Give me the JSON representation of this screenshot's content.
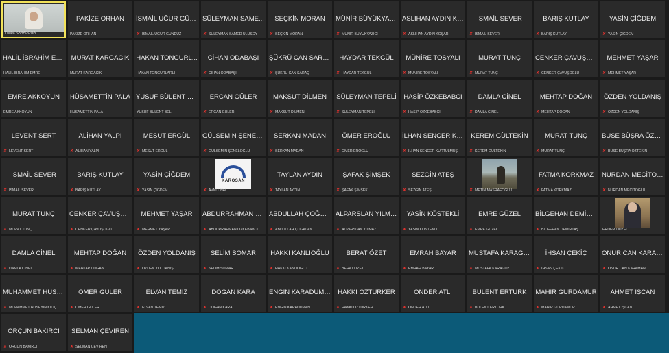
{
  "self": {
    "small": "Tuğba KARABOĞA"
  },
  "tiles": [
    {
      "big": "PAKİZE ORHAN",
      "small": "PAKİZE ORHAN",
      "mic": false
    },
    {
      "big": "İSMAİL UĞUR GÜN...",
      "small": "İSMAİL UĞUR GÜNDÜZ",
      "mic": true
    },
    {
      "big": "SÜLEYMAN SAME...",
      "small": "SÜLEYMAN SAMED ULUSOY",
      "mic": true
    },
    {
      "big": "SEÇKİN MORAN",
      "small": "SEÇKİN MORAN",
      "mic": true
    },
    {
      "big": "MÜNİR BÜYÜKYAZI...",
      "small": "MÜNİR BÜYÜKYAZICI",
      "mic": true
    },
    {
      "big": "ASLIHAN AYDIN KO...",
      "small": "ASLIHAN AYDIN KOŞAR",
      "mic": true
    },
    {
      "big": "İSMAİL SEVER",
      "small": "İSMAİL SEVER",
      "mic": true
    },
    {
      "big": "BARIŞ KUTLAY",
      "small": "BARIŞ KUTLAY",
      "mic": true
    },
    {
      "big": "YASİN ÇİĞDEM",
      "small": "YASİN ÇİĞDEM",
      "mic": true
    },
    {
      "big": "HALİL İBRAHİM EM...",
      "small": "HALİL İBRAHİM EMRE",
      "mic": false
    },
    {
      "big": "MURAT KARGACIK",
      "small": "MURAT KARGACIK",
      "mic": false
    },
    {
      "big": "HAKAN TONGURL...",
      "small": "HAKAN TONGURLARLI",
      "mic": false
    },
    {
      "big": "CİHAN ODABAŞI",
      "small": "CİHAN ODABAŞI",
      "mic": true
    },
    {
      "big": "ŞÜKRÜ CAN SARAÇ",
      "small": "ŞÜKRÜ CAN SARAÇ",
      "mic": true
    },
    {
      "big": "HAYDAR TEKGÜL",
      "small": "HAYDAR TEKGÜL",
      "mic": true
    },
    {
      "big": "MÜNİRE TOSYALI",
      "small": "MÜNİRE TOSYALI",
      "mic": true
    },
    {
      "big": "MURAT TUNÇ",
      "small": "MURAT TUNÇ",
      "mic": true
    },
    {
      "big": "CENKER ÇAVUŞOĞ...",
      "small": "CENKER ÇAVUŞOĞLU",
      "mic": true
    },
    {
      "big": "MEHMET YAŞAR",
      "small": "MEHMET YAŞAR",
      "mic": true
    },
    {
      "big": "EMRE AKKOYUN",
      "small": "EMRE AKKOYUN",
      "mic": false
    },
    {
      "big": "HÜSAMETTİN PALA",
      "small": "HÜSAMETTİN PALA",
      "mic": false
    },
    {
      "big": "YUSUF BÜLENT BEL",
      "small": "YUSUF BÜLENT BEL",
      "mic": false
    },
    {
      "big": "ERCAN GÜLER",
      "small": "ERCAN GÜLER",
      "mic": true
    },
    {
      "big": "MAKSUT DİLMEN",
      "small": "MAKSUT DİLMEN",
      "mic": true
    },
    {
      "big": "SÜLEYMAN TEPELİ",
      "small": "SÜLEYMAN TEPELİ",
      "mic": true
    },
    {
      "big": "HASİP ÖZKEBABCI",
      "small": "HASİP ÖZKEBABCI",
      "mic": true
    },
    {
      "big": "DAMLA CİNEL",
      "small": "DAMLA CİNEL",
      "mic": true
    },
    {
      "big": "MEHTAP DOĞAN",
      "small": "MEHTAP DOĞAN",
      "mic": true
    },
    {
      "big": "ÖZDEN YOLDANIŞ",
      "small": "ÖZDEN YOLDANIŞ",
      "mic": true
    },
    {
      "big": "LEVENT SERT",
      "small": "LEVENT SERT",
      "mic": true
    },
    {
      "big": "ALİHAN YALPI",
      "small": "ALİHAN YALPI",
      "mic": true
    },
    {
      "big": "MESUT ERGÜL",
      "small": "MESUT ERGÜL",
      "mic": true
    },
    {
      "big": "GÜLSEMİN ŞENEL...",
      "small": "GÜLSEMİN ŞENELOĞLU",
      "mic": true
    },
    {
      "big": "SERKAN MADAN",
      "small": "SERKAN MADAN",
      "mic": true
    },
    {
      "big": "ÖMER EROĞLU",
      "small": "ÖMER EROĞLU",
      "mic": true
    },
    {
      "big": "İLHAN SENCER KU...",
      "small": "İLHAN SENCER KURTULMUŞ",
      "mic": true
    },
    {
      "big": "KEREM GÜLTEKİN",
      "small": "KEREM GÜLTEKİN",
      "mic": true
    },
    {
      "big": "MURAT TUNÇ",
      "small": "MURAT TUNÇ",
      "mic": true
    },
    {
      "big": "BUSE BÜŞRA ÖZTE...",
      "small": "BUSE BÜŞRA ÖZTEKİN",
      "mic": true
    },
    {
      "big": "İSMAİL SEVER",
      "small": "İSMAİL SEVER",
      "mic": true
    },
    {
      "big": "BARIŞ KUTLAY",
      "small": "BARIŞ KUTLAY",
      "mic": true
    },
    {
      "big": "YASİN ÇİĞDEM",
      "small": "YASİN ÇİĞDEM",
      "mic": true
    },
    {
      "big": "",
      "small": "AVNİ ÜNAL",
      "mic": true,
      "cam": "logo"
    },
    {
      "big": "TAYLAN AYDIN",
      "small": "TAYLAN AYDIN",
      "mic": true
    },
    {
      "big": "ŞAFAK ŞİMŞEK",
      "small": "ŞAFAK ŞİMŞEK",
      "mic": true
    },
    {
      "big": "SEZGİN ATEŞ",
      "small": "SEZGİN ATEŞ",
      "mic": true
    },
    {
      "big": "",
      "small": "METİN MASRAFOĞLU",
      "mic": true,
      "cam": "landscape"
    },
    {
      "big": "FATMA KORKMAZ",
      "small": "FATMA KORKMAZ",
      "mic": true
    },
    {
      "big": "NURDAN MECİTOĞ...",
      "small": "NURDAN MECİTOĞLU",
      "mic": true
    },
    {
      "big": "MURAT TUNÇ",
      "small": "MURAT TUNÇ",
      "mic": true
    },
    {
      "big": "CENKER ÇAVUŞOĞ...",
      "small": "CENKER ÇAVUŞOĞLU",
      "mic": true
    },
    {
      "big": "MEHMET YAŞAR",
      "small": "MEHMET YAŞAR",
      "mic": true
    },
    {
      "big": "ABDURRAHMAN Ö...",
      "small": "ABDURRAHMAN ÖZKEBABCI",
      "mic": true
    },
    {
      "big": "ABDULLAH ÇOĞAL...",
      "small": "ABDULLAH ÇOĞALAN",
      "mic": true
    },
    {
      "big": "ALPARSLAN YILMAZ",
      "small": "ALPARSLAN YILMAZ",
      "mic": true
    },
    {
      "big": "YASİN KÖSTEKLİ",
      "small": "YASİN KÖSTEKLİ",
      "mic": true
    },
    {
      "big": "EMRE GÜZEL",
      "small": "EMRE GÜZEL",
      "mic": true
    },
    {
      "big": "BİLGEHAN DEMİRT...",
      "small": "BİLGEHAN DEMİRTAŞ",
      "mic": true
    },
    {
      "big": "",
      "small": "ERDEM DÜZEL",
      "mic": false,
      "cam": "office"
    },
    {
      "big": "DAMLA CİNEL",
      "small": "DAMLA CİNEL",
      "mic": true
    },
    {
      "big": "MEHTAP DOĞAN",
      "small": "MEHTAP DOĞAN",
      "mic": true
    },
    {
      "big": "ÖZDEN YOLDANIŞ",
      "small": "ÖZDEN YOLDANIŞ",
      "mic": true
    },
    {
      "big": "SELİM SOMAR",
      "small": "SELİM SOMAR",
      "mic": true
    },
    {
      "big": "HAKKI KANLIOĞLU",
      "small": "HAKKI KANLIOĞLU",
      "mic": true
    },
    {
      "big": "BERAT ÖZET",
      "small": "BERAT ÖZET",
      "mic": true
    },
    {
      "big": "EMRAH BAYAR",
      "small": "EMRAH BAYAR",
      "mic": true
    },
    {
      "big": "MUSTAFA KARAGÖZ",
      "small": "MUSTAFA KARAGÖZ",
      "mic": true
    },
    {
      "big": "İHSAN ÇEKİÇ",
      "small": "İHSAN ÇEKİÇ",
      "mic": true
    },
    {
      "big": "ONUR CAN KARAM...",
      "small": "ONUR CAN KARAMAN",
      "mic": true
    },
    {
      "big": "MUHAMMET HÜSE...",
      "small": "MUHAMMET HÜSEYİN KILIÇ",
      "mic": true
    },
    {
      "big": "ÖMER GÜLER",
      "small": "ÖMER GÜLER",
      "mic": true
    },
    {
      "big": "ELVAN TEMİZ",
      "small": "ELVAN TEMİZ",
      "mic": true
    },
    {
      "big": "DOĞAN KARA",
      "small": "DOĞAN KARA",
      "mic": true
    },
    {
      "big": "ENGİN KARADUMAN",
      "small": "ENGİN KARADUMAN",
      "mic": true
    },
    {
      "big": "HAKKI ÖZTÜRKER",
      "small": "HAKKI ÖZTÜRKER",
      "mic": true
    },
    {
      "big": "ÖNDER ATLI",
      "small": "ÖNDER ATLI",
      "mic": true
    },
    {
      "big": "BÜLENT ERTÜRK",
      "small": "BÜLENT ERTÜRK",
      "mic": true
    },
    {
      "big": "MAHİR GÜRDAMUR",
      "small": "MAHİR GÜRDAMUR",
      "mic": true
    },
    {
      "big": "AHMET İŞCAN",
      "small": "AHMET İŞCAN",
      "mic": true
    },
    {
      "big": "ORÇUN BAKIRCI",
      "small": "ORÇUN BAKIRCI",
      "mic": true
    },
    {
      "big": "SELMAN ÇEVİREN",
      "small": "SELMAN ÇEVİREN",
      "mic": true
    }
  ],
  "logo_text": "KAROSAN",
  "colors": {
    "tile_bg": "#2a2a2a",
    "active_border": "#f2e25a",
    "mic_muted": "#e0322e",
    "filler": "#0c5a78"
  }
}
